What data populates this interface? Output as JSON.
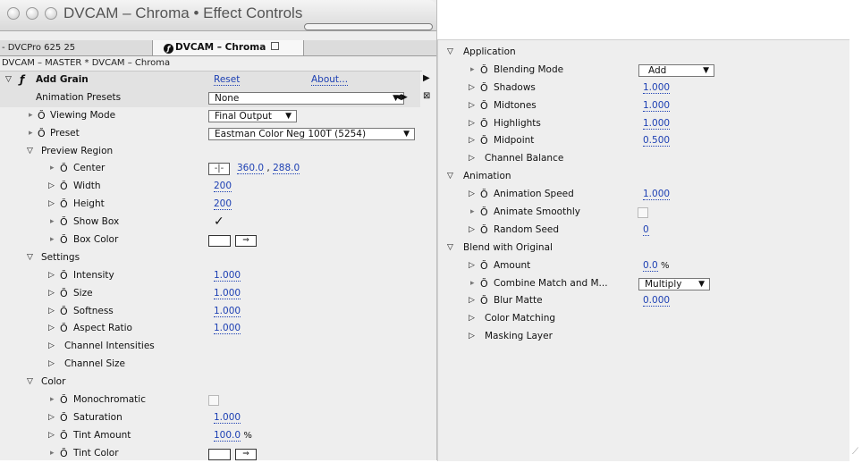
{
  "window": {
    "title": "DVCAM – Chroma • Effect Controls"
  },
  "tabs": [
    {
      "label": "- DVCPro 625 25"
    },
    {
      "label": "DVCAM – Chroma"
    }
  ],
  "subheader": "DVCAM – MASTER * DVCAM – Chroma",
  "effect": {
    "name": "Add Grain",
    "reset_label": "Reset",
    "about_label": "About..."
  },
  "left_rows": {
    "animation_presets": {
      "label": "Animation Presets",
      "value": "None"
    },
    "viewing_mode": {
      "label": "Viewing Mode",
      "value": "Final Output"
    },
    "preset": {
      "label": "Preset",
      "value": "Eastman Color Neg 100T (5254)"
    },
    "preview_region": {
      "label": "Preview Region"
    },
    "center": {
      "label": "Center",
      "x": "360.0",
      "sep": ",",
      "y": "288.0"
    },
    "width": {
      "label": "Width",
      "value": "200"
    },
    "height": {
      "label": "Height",
      "value": "200"
    },
    "show_box": {
      "label": "Show Box",
      "check": "✓"
    },
    "box_color": {
      "label": "Box Color"
    },
    "settings": {
      "label": "Settings"
    },
    "intensity": {
      "label": "Intensity",
      "value": "1.000"
    },
    "size": {
      "label": "Size",
      "value": "1.000"
    },
    "softness": {
      "label": "Softness",
      "value": "1.000"
    },
    "aspect_ratio": {
      "label": "Aspect Ratio",
      "value": "1.000"
    },
    "channel_intensities": {
      "label": "Channel Intensities"
    },
    "channel_size": {
      "label": "Channel Size"
    },
    "color": {
      "label": "Color"
    },
    "monochromatic": {
      "label": "Monochromatic"
    },
    "saturation": {
      "label": "Saturation",
      "value": "1.000"
    },
    "tint_amount": {
      "label": "Tint Amount",
      "value": "100.0",
      "unit": "%"
    },
    "tint_color": {
      "label": "Tint Color"
    }
  },
  "right_rows": {
    "application": {
      "label": "Application"
    },
    "blending_mode": {
      "label": "Blending Mode",
      "value": "Add"
    },
    "shadows": {
      "label": "Shadows",
      "value": "1.000"
    },
    "midtones": {
      "label": "Midtones",
      "value": "1.000"
    },
    "highlights": {
      "label": "Highlights",
      "value": "1.000"
    },
    "midpoint": {
      "label": "Midpoint",
      "value": "0.500"
    },
    "channel_balance": {
      "label": "Channel Balance"
    },
    "animation": {
      "label": "Animation"
    },
    "animation_speed": {
      "label": "Animation Speed",
      "value": "1.000"
    },
    "animate_smoothly": {
      "label": "Animate Smoothly"
    },
    "random_seed": {
      "label": "Random Seed",
      "value": "0"
    },
    "blend_with_original": {
      "label": "Blend with Original"
    },
    "amount": {
      "label": "Amount",
      "value": "0.0",
      "unit": "%"
    },
    "combine_match": {
      "label": "Combine Match and M...",
      "value": "Multiply"
    },
    "blur_matte": {
      "label": "Blur Matte",
      "value": "0.000"
    },
    "color_matching": {
      "label": "Color Matching"
    },
    "masking_layer": {
      "label": "Masking Layer"
    }
  },
  "icons": {
    "stopwatch": "Ŏ",
    "tri_down": "▽",
    "tri_right": "▷",
    "dot": "▸",
    "dropdown_arrow": "▼",
    "fx": "ƒ",
    "eyedropper": "⇒",
    "crosshair": "-|-"
  },
  "colors": {
    "link": "#1c3fb3",
    "panel_bg": "#eeeeee"
  }
}
